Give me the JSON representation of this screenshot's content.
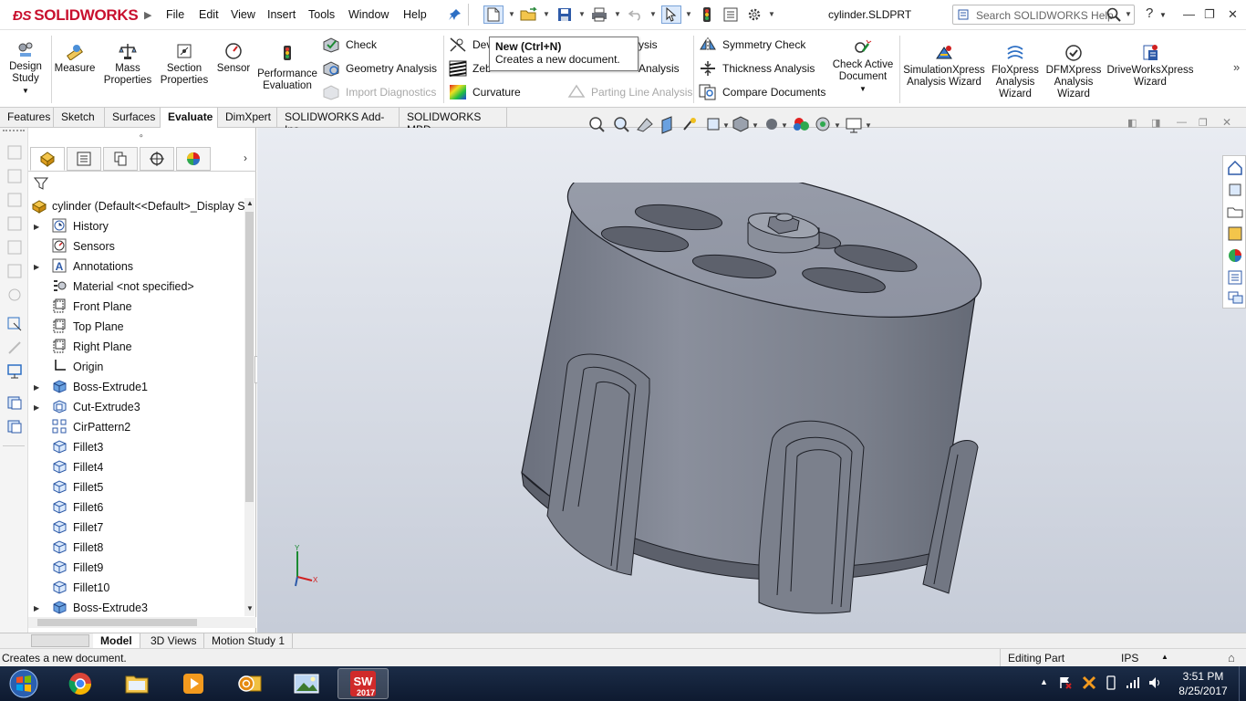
{
  "app": {
    "brand": "SOLIDWORKS",
    "document_title": "cylinder.SLDPRT"
  },
  "menu": [
    "File",
    "Edit",
    "View",
    "Insert",
    "Tools",
    "Window",
    "Help"
  ],
  "search": {
    "placeholder": "Search SOLIDWORKS Help"
  },
  "tooltip": {
    "title": "New  (Ctrl+N)",
    "description": "Creates a new document."
  },
  "commands": {
    "design_study": "Design Study",
    "measure": "Measure",
    "mass_properties": "Mass Properties",
    "section_properties": "Section Properties",
    "sensor": "Sensor",
    "performance_evaluation": "Performance Evaluation",
    "check": "Check",
    "geometry_analysis": "Geometry Analysis",
    "import_diagnostics": "Import Diagnostics",
    "deviation_partial": "Dev",
    "deviation_analysis_tail": "ysis",
    "zebra_partial": "Zeb",
    "undercut_analysis_tail": "Analysis",
    "curvature": "Curvature",
    "parting_line_analysis": "Parting Line Analysis",
    "symmetry_check": "Symmetry Check",
    "thickness_analysis": "Thickness Analysis",
    "compare_documents": "Compare Documents",
    "check_active_document": "Check Active Document",
    "simulationxpress": "SimulationXpress Analysis Wizard",
    "floxpress": "FloXpress Analysis Wizard",
    "dfmxpress": "DFMXpress Analysis Wizard",
    "driveworksxpress": "DriveWorksXpress Wizard"
  },
  "tabs": [
    "Features",
    "Sketch",
    "Surfaces",
    "Evaluate",
    "DimXpert",
    "SOLIDWORKS Add-Ins",
    "SOLIDWORKS MBD"
  ],
  "active_tab": "Evaluate",
  "tree": {
    "root": "cylinder  (Default<<Default>_Display St",
    "items": [
      {
        "label": "History",
        "expandable": true
      },
      {
        "label": "Sensors",
        "expandable": false
      },
      {
        "label": "Annotations",
        "expandable": true
      },
      {
        "label": "Material <not specified>",
        "expandable": false
      },
      {
        "label": "Front Plane",
        "expandable": false
      },
      {
        "label": "Top Plane",
        "expandable": false
      },
      {
        "label": "Right Plane",
        "expandable": false
      },
      {
        "label": "Origin",
        "expandable": false
      },
      {
        "label": "Boss-Extrude1",
        "expandable": true
      },
      {
        "label": "Cut-Extrude3",
        "expandable": true
      },
      {
        "label": "CirPattern2",
        "expandable": false
      },
      {
        "label": "Fillet3",
        "expandable": false
      },
      {
        "label": "Fillet4",
        "expandable": false
      },
      {
        "label": "Fillet5",
        "expandable": false
      },
      {
        "label": "Fillet6",
        "expandable": false
      },
      {
        "label": "Fillet7",
        "expandable": false
      },
      {
        "label": "Fillet8",
        "expandable": false
      },
      {
        "label": "Fillet9",
        "expandable": false
      },
      {
        "label": "Fillet10",
        "expandable": false
      },
      {
        "label": "Boss-Extrude3",
        "expandable": true
      }
    ]
  },
  "bottom_tabs": [
    "Model",
    "3D Views",
    "Motion Study 1"
  ],
  "status": {
    "message": "Creates a new document.",
    "mode": "Editing Part",
    "units": "IPS"
  },
  "taskbar": {
    "apps": [
      "start",
      "chrome-icon",
      "file-explorer-icon",
      "media-player-icon",
      "outlook-icon",
      "photo-viewer-icon",
      "solidworks-2017-icon"
    ],
    "sw_version": "2017",
    "time": "3:51 PM",
    "date": "8/25/2017"
  },
  "colors": {
    "brand_red": "#c8102e",
    "model_gray": "#7d8290",
    "viewport_top": "#e9ecf2",
    "viewport_bottom": "#c6ccd8"
  }
}
